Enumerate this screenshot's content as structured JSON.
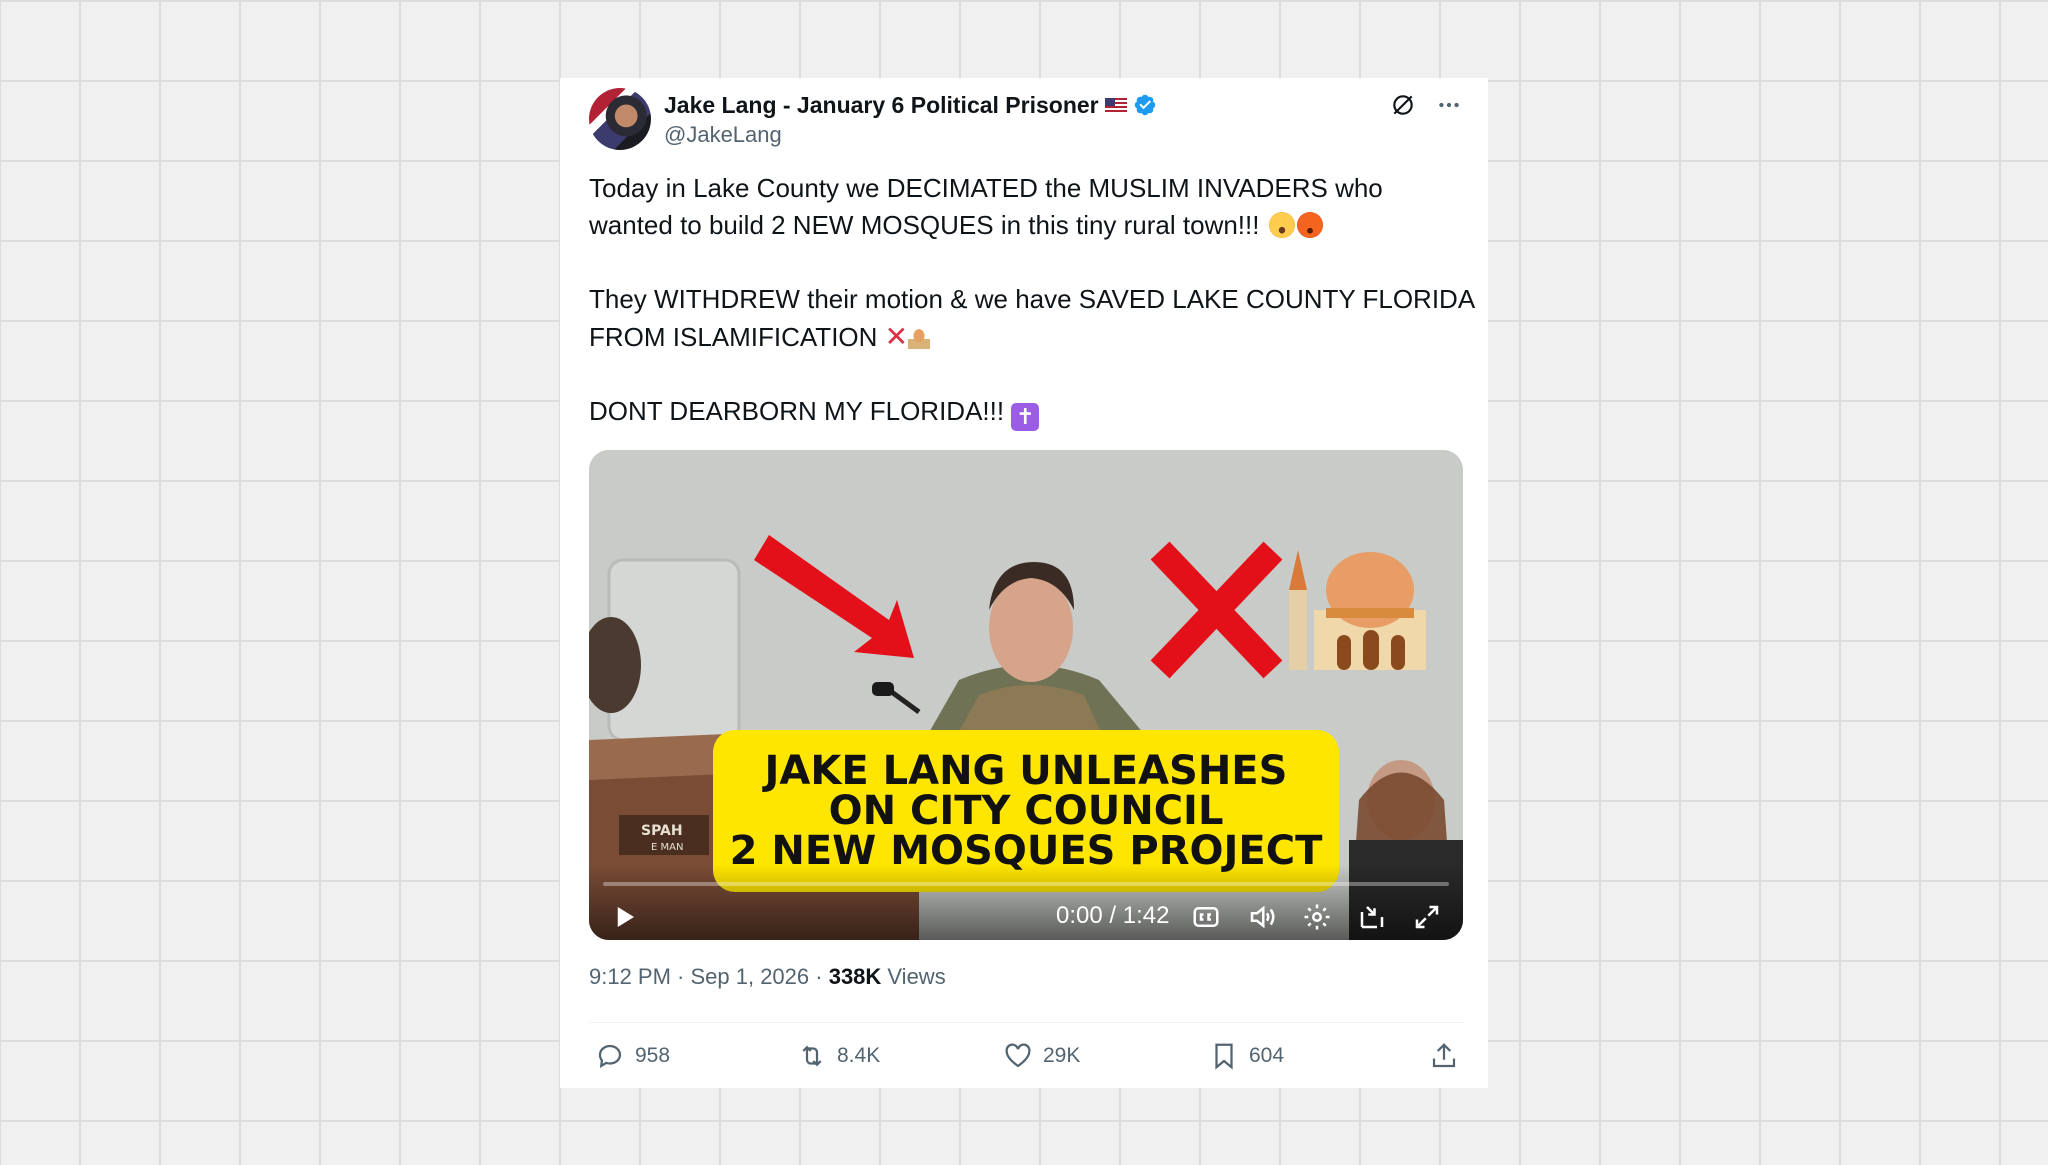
{
  "post": {
    "author_name": "Jake Lang - January 6 Political Prisoner",
    "handle": "@JakeLang",
    "verified": true,
    "paragraphs": [
      {
        "lines": [
          "Today in Lake County we DECIMATED the MUSLIM INVADERS who",
          "wanted to build 2 NEW MOSQUES in this tiny rural town!!!"
        ]
      },
      {
        "lines": [
          "They WITHDREW their motion & we have SAVED LAKE COUNTY FLORIDA",
          "FROM ISLAMIFICATION"
        ]
      },
      {
        "lines": [
          "DONT DEARBORN MY FLORIDA!!!"
        ]
      }
    ],
    "emoji_icons": [
      "astonished-face-emoji",
      "angry-face-emoji",
      "red-x-emoji",
      "mosque-emoji",
      "latin-cross-emoji"
    ],
    "video": {
      "banner_lines": [
        "JAKE LANG UNLEASHES",
        "ON CITY COUNCIL",
        "2 NEW MOSQUES PROJECT"
      ],
      "time_display": "0:00 / 1:42",
      "progress": 0,
      "controls": [
        "play-icon",
        "captions-icon",
        "volume-icon",
        "settings-icon",
        "pip-icon",
        "fullscreen-icon"
      ]
    },
    "timestamp": "9:12 PM · Sep 1, 2026 · ",
    "views_count": "338K",
    "views_label": " Views",
    "actions": {
      "replies": "958",
      "reposts": "8.4K",
      "likes": "29K",
      "bookmarks": "604"
    }
  },
  "colors": {
    "verified_blue": "#1d9bf0",
    "text_primary": "#0f1419",
    "text_secondary": "#536471",
    "banner_yellow": "#ffe600"
  }
}
